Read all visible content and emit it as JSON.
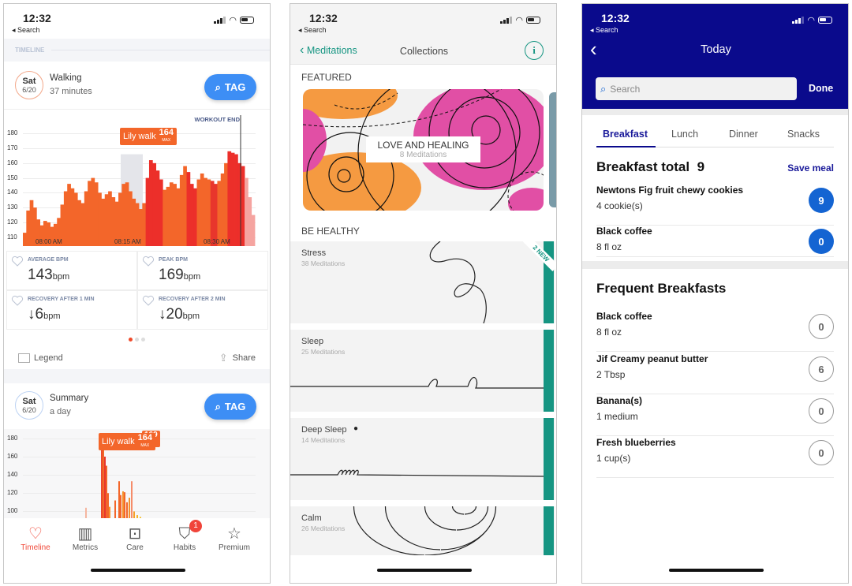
{
  "status": {
    "time": "12:32",
    "back": "◂ Search"
  },
  "heart": {
    "section_label": "TIMELINE",
    "card1": {
      "day": "Sat",
      "date": "6/20",
      "title": "Walking",
      "subtitle": "37 minutes",
      "tag_label": "TAG",
      "workout_end": "WORKOUT END",
      "tooltip": {
        "name": "Lily walk",
        "value": "164",
        "unit": "MAX"
      }
    },
    "stats": [
      {
        "label": "AVERAGE BPM",
        "value": "143",
        "unit": "bpm",
        "arrow": ""
      },
      {
        "label": "PEAK BPM",
        "value": "169",
        "unit": "bpm",
        "arrow": ""
      },
      {
        "label": "RECOVERY AFTER 1 MIN",
        "value": "6",
        "unit": "bpm",
        "arrow": "↓"
      },
      {
        "label": "RECOVERY AFTER 2 MIN",
        "value": "20",
        "unit": "bpm",
        "arrow": "↓"
      }
    ],
    "legend_label": "Legend",
    "share_label": "Share",
    "card2": {
      "day": "Sat",
      "date": "6/20",
      "title": "Summary",
      "subtitle": "a day",
      "tag_label": "TAG",
      "tooltip": {
        "name": "Lily walk",
        "value": "164",
        "unit": "MAX",
        "behind_value": "169",
        "behind_unit": "AX"
      }
    },
    "tabs": [
      {
        "label": "Timeline",
        "active": true
      },
      {
        "label": "Metrics"
      },
      {
        "label": "Care"
      },
      {
        "label": "Habits",
        "badge": "1"
      },
      {
        "label": "Premium"
      }
    ],
    "accent": "#f06a2a"
  },
  "chart_data": [
    {
      "type": "area",
      "ylim": [
        104,
        186
      ],
      "yticks": [
        "180",
        "170",
        "160",
        "150",
        "140",
        "130",
        "120",
        "110"
      ],
      "xticks": [
        "08:00 AM",
        "08:15 AM",
        "08:30 AM"
      ],
      "x_range": [
        "07:55 AM",
        "08:35 AM"
      ],
      "values": [
        113,
        128,
        135,
        130,
        122,
        118,
        121,
        120,
        117,
        119,
        123,
        132,
        141,
        146,
        143,
        140,
        135,
        133,
        141,
        148,
        150,
        147,
        140,
        136,
        139,
        141,
        137,
        134,
        140,
        146,
        147,
        141,
        136,
        133,
        129,
        133,
        150,
        162,
        160,
        155,
        149,
        142,
        144,
        147,
        146,
        143,
        152,
        158,
        154,
        146,
        143,
        149,
        153,
        150,
        149,
        148,
        146,
        148,
        153,
        160,
        168,
        167,
        166,
        160,
        158,
        150,
        137,
        125
      ]
    },
    {
      "type": "bar",
      "ylim": [
        90,
        185
      ],
      "yticks": [
        "180",
        "160",
        "140",
        "120",
        "100"
      ]
    }
  ],
  "meditation": {
    "back_label": "Meditations",
    "title": "Collections",
    "info_icon": "info-icon",
    "featured_label": "FEATURED",
    "featured": {
      "title": "LOVE AND HEALING",
      "subtitle": "8 Meditations"
    },
    "section2_label": "BE HEALTHY",
    "items": [
      {
        "title": "Stress",
        "subtitle": "38 Meditations",
        "ribbon": "2 NEW"
      },
      {
        "title": "Sleep",
        "subtitle": "25 Meditations"
      },
      {
        "title": "Deep Sleep",
        "subtitle": "14 Meditations"
      },
      {
        "title": "Calm",
        "subtitle": "26 Meditations"
      }
    ],
    "accent": "#169582"
  },
  "food": {
    "title": "Today",
    "search_placeholder": "Search",
    "done_label": "Done",
    "tabs": [
      "Breakfast",
      "Lunch",
      "Dinner",
      "Snacks"
    ],
    "active_tab": "Breakfast",
    "total_label": "Breakfast total",
    "total_value": "9",
    "save_label": "Save meal",
    "logged": [
      {
        "name": "Newtons Fig fruit chewy cookies",
        "qty": "4 cookie(s)",
        "points": "9"
      },
      {
        "name": "Black coffee",
        "qty": "8 fl oz",
        "points": "0"
      }
    ],
    "frequent_title": "Frequent Breakfasts",
    "frequent": [
      {
        "name": "Black coffee",
        "qty": "8 fl oz",
        "points": "0"
      },
      {
        "name": "Jif Creamy peanut butter",
        "qty": "2 Tbsp",
        "points": "6"
      },
      {
        "name": "Banana(s)",
        "qty": "1 medium",
        "points": "0"
      },
      {
        "name": "Fresh blueberries",
        "qty": "1 cup(s)",
        "points": "0"
      }
    ],
    "header_color": "#0a0a8c"
  }
}
